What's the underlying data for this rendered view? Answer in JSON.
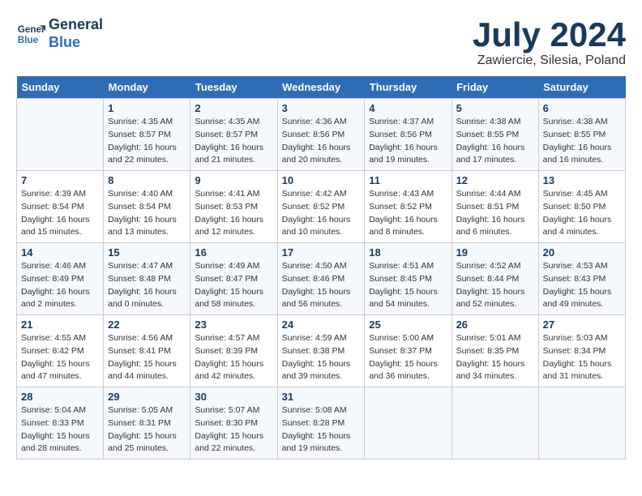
{
  "header": {
    "logo_line1": "General",
    "logo_line2": "Blue",
    "month": "July 2024",
    "location": "Zawiercie, Silesia, Poland"
  },
  "days_of_week": [
    "Sunday",
    "Monday",
    "Tuesday",
    "Wednesday",
    "Thursday",
    "Friday",
    "Saturday"
  ],
  "weeks": [
    [
      {
        "day": "",
        "info": ""
      },
      {
        "day": "1",
        "info": "Sunrise: 4:35 AM\nSunset: 8:57 PM\nDaylight: 16 hours\nand 22 minutes."
      },
      {
        "day": "2",
        "info": "Sunrise: 4:35 AM\nSunset: 8:57 PM\nDaylight: 16 hours\nand 21 minutes."
      },
      {
        "day": "3",
        "info": "Sunrise: 4:36 AM\nSunset: 8:56 PM\nDaylight: 16 hours\nand 20 minutes."
      },
      {
        "day": "4",
        "info": "Sunrise: 4:37 AM\nSunset: 8:56 PM\nDaylight: 16 hours\nand 19 minutes."
      },
      {
        "day": "5",
        "info": "Sunrise: 4:38 AM\nSunset: 8:55 PM\nDaylight: 16 hours\nand 17 minutes."
      },
      {
        "day": "6",
        "info": "Sunrise: 4:38 AM\nSunset: 8:55 PM\nDaylight: 16 hours\nand 16 minutes."
      }
    ],
    [
      {
        "day": "7",
        "info": "Sunrise: 4:39 AM\nSunset: 8:54 PM\nDaylight: 16 hours\nand 15 minutes."
      },
      {
        "day": "8",
        "info": "Sunrise: 4:40 AM\nSunset: 8:54 PM\nDaylight: 16 hours\nand 13 minutes."
      },
      {
        "day": "9",
        "info": "Sunrise: 4:41 AM\nSunset: 8:53 PM\nDaylight: 16 hours\nand 12 minutes."
      },
      {
        "day": "10",
        "info": "Sunrise: 4:42 AM\nSunset: 8:52 PM\nDaylight: 16 hours\nand 10 minutes."
      },
      {
        "day": "11",
        "info": "Sunrise: 4:43 AM\nSunset: 8:52 PM\nDaylight: 16 hours\nand 8 minutes."
      },
      {
        "day": "12",
        "info": "Sunrise: 4:44 AM\nSunset: 8:51 PM\nDaylight: 16 hours\nand 6 minutes."
      },
      {
        "day": "13",
        "info": "Sunrise: 4:45 AM\nSunset: 8:50 PM\nDaylight: 16 hours\nand 4 minutes."
      }
    ],
    [
      {
        "day": "14",
        "info": "Sunrise: 4:46 AM\nSunset: 8:49 PM\nDaylight: 16 hours\nand 2 minutes."
      },
      {
        "day": "15",
        "info": "Sunrise: 4:47 AM\nSunset: 8:48 PM\nDaylight: 16 hours\nand 0 minutes."
      },
      {
        "day": "16",
        "info": "Sunrise: 4:49 AM\nSunset: 8:47 PM\nDaylight: 15 hours\nand 58 minutes."
      },
      {
        "day": "17",
        "info": "Sunrise: 4:50 AM\nSunset: 8:46 PM\nDaylight: 15 hours\nand 56 minutes."
      },
      {
        "day": "18",
        "info": "Sunrise: 4:51 AM\nSunset: 8:45 PM\nDaylight: 15 hours\nand 54 minutes."
      },
      {
        "day": "19",
        "info": "Sunrise: 4:52 AM\nSunset: 8:44 PM\nDaylight: 15 hours\nand 52 minutes."
      },
      {
        "day": "20",
        "info": "Sunrise: 4:53 AM\nSunset: 8:43 PM\nDaylight: 15 hours\nand 49 minutes."
      }
    ],
    [
      {
        "day": "21",
        "info": "Sunrise: 4:55 AM\nSunset: 8:42 PM\nDaylight: 15 hours\nand 47 minutes."
      },
      {
        "day": "22",
        "info": "Sunrise: 4:56 AM\nSunset: 8:41 PM\nDaylight: 15 hours\nand 44 minutes."
      },
      {
        "day": "23",
        "info": "Sunrise: 4:57 AM\nSunset: 8:39 PM\nDaylight: 15 hours\nand 42 minutes."
      },
      {
        "day": "24",
        "info": "Sunrise: 4:59 AM\nSunset: 8:38 PM\nDaylight: 15 hours\nand 39 minutes."
      },
      {
        "day": "25",
        "info": "Sunrise: 5:00 AM\nSunset: 8:37 PM\nDaylight: 15 hours\nand 36 minutes."
      },
      {
        "day": "26",
        "info": "Sunrise: 5:01 AM\nSunset: 8:35 PM\nDaylight: 15 hours\nand 34 minutes."
      },
      {
        "day": "27",
        "info": "Sunrise: 5:03 AM\nSunset: 8:34 PM\nDaylight: 15 hours\nand 31 minutes."
      }
    ],
    [
      {
        "day": "28",
        "info": "Sunrise: 5:04 AM\nSunset: 8:33 PM\nDaylight: 15 hours\nand 28 minutes."
      },
      {
        "day": "29",
        "info": "Sunrise: 5:05 AM\nSunset: 8:31 PM\nDaylight: 15 hours\nand 25 minutes."
      },
      {
        "day": "30",
        "info": "Sunrise: 5:07 AM\nSunset: 8:30 PM\nDaylight: 15 hours\nand 22 minutes."
      },
      {
        "day": "31",
        "info": "Sunrise: 5:08 AM\nSunset: 8:28 PM\nDaylight: 15 hours\nand 19 minutes."
      },
      {
        "day": "",
        "info": ""
      },
      {
        "day": "",
        "info": ""
      },
      {
        "day": "",
        "info": ""
      }
    ]
  ]
}
